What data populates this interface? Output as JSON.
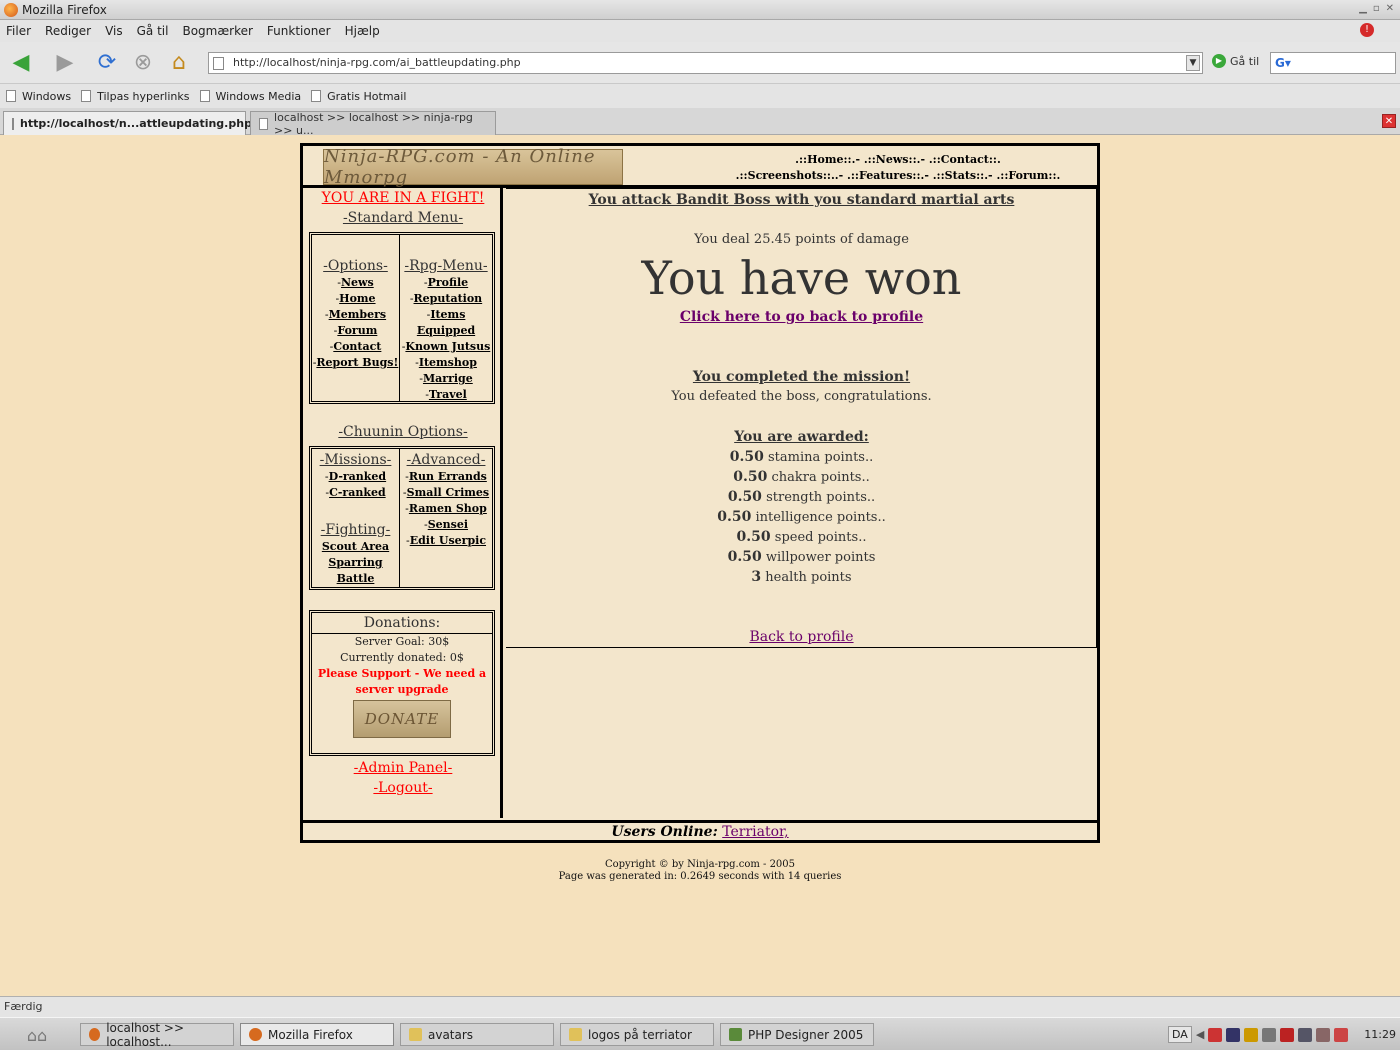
{
  "window": {
    "title": "Mozilla Firefox"
  },
  "menu": [
    "Filer",
    "Rediger",
    "Vis",
    "Gå til",
    "Bogmærker",
    "Funktioner",
    "Hjælp"
  ],
  "address": {
    "url": "http://localhost/ninja-rpg.com/ai_battleupdating.php",
    "go_label": "Gå til"
  },
  "bookmarks": [
    "Windows",
    "Tilpas hyperlinks",
    "Windows Media",
    "Gratis Hotmail"
  ],
  "tabs": [
    "http://localhost/n...attleupdating.php",
    "localhost >> localhost >> ninja-rpg >> u..."
  ],
  "site": {
    "logo": "Ninja-RPG.com - An Online Mmorpg",
    "topnav_line1": ".::Home::.- .::News::.- .::Contact::.",
    "topnav_line2": ".::Screenshots::..- .::Features::.- .::Stats::.- .::Forum::.",
    "fight_notice": "YOU ARE IN A FIGHT!",
    "standard_menu": "-Standard Menu-",
    "options_header": "-Options-",
    "options": [
      "News",
      "Home",
      "Members",
      "Forum",
      "Contact",
      "Report Bugs!"
    ],
    "rpg_header": "-Rpg-Menu-",
    "rpg": [
      "Profile",
      "Reputation",
      "Items Equipped",
      "Known Jutsus",
      "Itemshop",
      "Marrige",
      "Travel"
    ],
    "chuunin_header": "-Chuunin Options-",
    "missions_header": "-Missions-",
    "missions": [
      "D-ranked",
      "C-ranked"
    ],
    "fighting_header": "-Fighting-",
    "fighting": [
      "Scout Area",
      "Sparring",
      "Battle"
    ],
    "advanced_header": "-Advanced-",
    "advanced": [
      "Run Errands",
      "Small Crimes",
      "Ramen Shop",
      "Sensei",
      "Edit Userpic"
    ],
    "donations": {
      "header": "Donations:",
      "goal": "Server Goal: 30$",
      "current": "Currently donated: 0$",
      "support_line1": "Please Support - We need a",
      "support_line2": "server upgrade",
      "button": "DONATE"
    },
    "admin": "-Admin Panel-",
    "logout": "-Logout-",
    "main": {
      "title": "You attack Bandit Boss with you standard martial arts",
      "damage": "You deal 25.45 points of damage",
      "won": "You have won",
      "back_link": "Click here to go back to profile",
      "mission_done": "You completed the mission!",
      "defeated": "You defeated the boss, congratulations.",
      "awarded": "You are awarded:",
      "rewards": [
        {
          "value": "0.50",
          "label": "stamina points.."
        },
        {
          "value": "0.50",
          "label": "chakra points.."
        },
        {
          "value": "0.50",
          "label": "strength points.."
        },
        {
          "value": "0.50",
          "label": "intelligence points.."
        },
        {
          "value": "0.50",
          "label": "speed points.."
        },
        {
          "value": "0.50",
          "label": "willpower points"
        },
        {
          "value": "3",
          "label": "health points"
        }
      ],
      "back_to_profile": "Back to profile"
    },
    "users_online_label": "Users Online:",
    "users_online": "Terriator,",
    "copyright": "Copyright © by Ninja-rpg.com - 2005",
    "generated": "Page was generated in: 0.2649 seconds with 14 queries"
  },
  "status": "Færdig",
  "taskbar": {
    "items": [
      "localhost >> localhost...",
      "Mozilla Firefox",
      "avatars",
      "logos på terriator",
      "PHP Designer 2005"
    ],
    "lang": "DA",
    "clock": "11:29"
  }
}
